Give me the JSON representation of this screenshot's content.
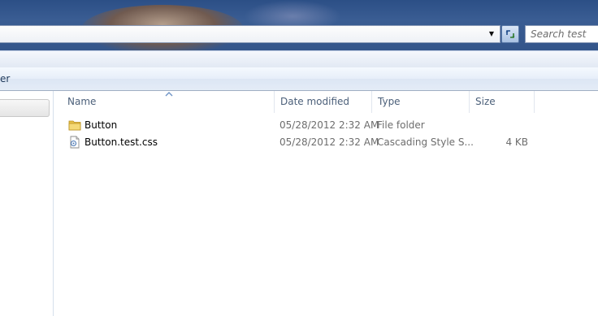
{
  "address_bar": {
    "search_placeholder": "Search test"
  },
  "toolbar": {
    "partial_label": "er"
  },
  "columns": [
    {
      "label": "Name"
    },
    {
      "label": "Date modified"
    },
    {
      "label": "Type"
    },
    {
      "label": "Size"
    }
  ],
  "files": [
    {
      "name": "Button",
      "icon": "folder-icon",
      "date": "05/28/2012 2:32 AM",
      "type": "File folder",
      "size": ""
    },
    {
      "name": "Button.test.css",
      "icon": "css-file-icon",
      "date": "05/28/2012 2:32 AM",
      "type": "Cascading Style S...",
      "size": "4 KB"
    }
  ],
  "colors": {
    "aero": "#34558a",
    "header_text": "#4c607a",
    "toolbar_text": "#1e395b"
  }
}
